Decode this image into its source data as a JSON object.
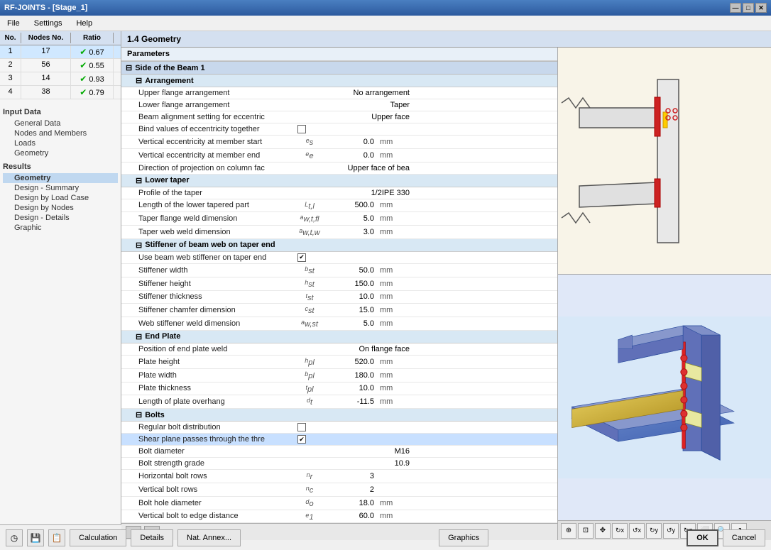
{
  "titlebar": {
    "title": "RF-JOINTS - [Stage_1]",
    "buttons": [
      "—",
      "□",
      "✕"
    ]
  },
  "menubar": {
    "items": [
      "File",
      "Settings",
      "Help"
    ]
  },
  "table": {
    "headers": [
      "No.",
      "Nodes No.",
      "Ratio"
    ],
    "rows": [
      {
        "no": "1",
        "nodes": "17",
        "status": "✔",
        "ratio": "0.67"
      },
      {
        "no": "2",
        "nodes": "56",
        "status": "✔",
        "ratio": "0.55"
      },
      {
        "no": "3",
        "nodes": "14",
        "status": "✔",
        "ratio": "0.93"
      },
      {
        "no": "4",
        "nodes": "38",
        "status": "✔",
        "ratio": "0.79"
      }
    ]
  },
  "nav": {
    "input_title": "Input Data",
    "input_items": [
      "General Data",
      "Nodes and Members",
      "Loads",
      "Geometry"
    ],
    "results_title": "Results",
    "results_items": [
      "Geometry",
      "Design - Summary",
      "Design by Load Case",
      "Design by Nodes",
      "Design - Details",
      "Graphic"
    ],
    "active": "Geometry"
  },
  "content_header": "1.4 Geometry",
  "params_label": "Parameters",
  "sections": [
    {
      "id": "side_beam1",
      "label": "Side of the Beam 1",
      "level": 1,
      "collapsed": false,
      "subsections": [
        {
          "id": "arrangement",
          "label": "Arrangement",
          "level": 2,
          "rows": [
            {
              "name": "Upper flange arrangement",
              "symbol": "",
              "value": "No arrangement",
              "unit": "",
              "type": "str"
            },
            {
              "name": "Lower flange arrangement",
              "symbol": "",
              "value": "Taper",
              "unit": "",
              "type": "str"
            },
            {
              "name": "Beam alignment setting for eccentric",
              "symbol": "",
              "value": "Upper face",
              "unit": "",
              "type": "str"
            },
            {
              "name": "Bind values of eccentricity together",
              "symbol": "",
              "value": "",
              "unit": "",
              "type": "check",
              "checked": false
            },
            {
              "name": "Vertical eccentricity at member start",
              "symbol": "es",
              "value": "0.0",
              "unit": "mm",
              "type": "num"
            },
            {
              "name": "Vertical eccentricity at member end",
              "symbol": "ee",
              "value": "0.0",
              "unit": "mm",
              "type": "num"
            },
            {
              "name": "Direction of projection on column fac",
              "symbol": "",
              "value": "Upper face of bea",
              "unit": "",
              "type": "str"
            }
          ]
        },
        {
          "id": "lower_taper",
          "label": "Lower taper",
          "level": 2,
          "rows": [
            {
              "name": "Profile of the taper",
              "symbol": "",
              "value": "1/2IPE 330",
              "unit": "",
              "type": "str"
            },
            {
              "name": "Length of the lower tapered part",
              "symbol": "Lt,l",
              "value": "500.0",
              "unit": "mm",
              "type": "num"
            },
            {
              "name": "Taper flange weld dimension",
              "symbol": "aw,t,fl",
              "value": "5.0",
              "unit": "mm",
              "type": "num"
            },
            {
              "name": "Taper web weld dimension",
              "symbol": "aw,t,w",
              "value": "3.0",
              "unit": "mm",
              "type": "num"
            }
          ]
        },
        {
          "id": "stiffener",
          "label": "Stiffener of beam web on taper end",
          "level": 2,
          "rows": [
            {
              "name": "Use beam web stiffener on taper end",
              "symbol": "",
              "value": "",
              "unit": "",
              "type": "check",
              "checked": true
            },
            {
              "name": "Stiffener width",
              "symbol": "bst",
              "value": "50.0",
              "unit": "mm",
              "type": "num"
            },
            {
              "name": "Stiffener height",
              "symbol": "hst",
              "value": "150.0",
              "unit": "mm",
              "type": "num"
            },
            {
              "name": "Stiffener thickness",
              "symbol": "tst",
              "value": "10.0",
              "unit": "mm",
              "type": "num"
            },
            {
              "name": "Stiffener chamfer dimension",
              "symbol": "cst",
              "value": "15.0",
              "unit": "mm",
              "type": "num"
            },
            {
              "name": "Web stiffener weld dimension",
              "symbol": "aw,st",
              "value": "5.0",
              "unit": "mm",
              "type": "num"
            }
          ]
        },
        {
          "id": "end_plate",
          "label": "End Plate",
          "level": 2,
          "rows": [
            {
              "name": "Position of end plate weld",
              "symbol": "",
              "value": "On flange face",
              "unit": "",
              "type": "str"
            },
            {
              "name": "Plate height",
              "symbol": "hpl",
              "value": "520.0",
              "unit": "mm",
              "type": "num"
            },
            {
              "name": "Plate width",
              "symbol": "bpl",
              "value": "180.0",
              "unit": "mm",
              "type": "num"
            },
            {
              "name": "Plate thickness",
              "symbol": "tpl",
              "value": "10.0",
              "unit": "mm",
              "type": "num"
            },
            {
              "name": "Length of plate overhang",
              "symbol": "dt",
              "value": "-11.5",
              "unit": "mm",
              "type": "num"
            }
          ]
        },
        {
          "id": "bolts",
          "label": "Bolts",
          "level": 2,
          "rows": [
            {
              "name": "Regular bolt distribution",
              "symbol": "",
              "value": "",
              "unit": "",
              "type": "check",
              "checked": false
            },
            {
              "name": "Shear plane passes through the thre",
              "symbol": "",
              "value": "",
              "unit": "",
              "type": "check",
              "checked": true
            },
            {
              "name": "Bolt diameter",
              "symbol": "",
              "value": "M16",
              "unit": "",
              "type": "str"
            },
            {
              "name": "Bolt strength grade",
              "symbol": "",
              "value": "10.9",
              "unit": "",
              "type": "str"
            },
            {
              "name": "Horizontal bolt rows",
              "symbol": "nr",
              "value": "3",
              "unit": "",
              "type": "num"
            },
            {
              "name": "Vertical bolt rows",
              "symbol": "nc",
              "value": "2",
              "unit": "",
              "type": "num"
            },
            {
              "name": "Bolt hole diameter",
              "symbol": "do",
              "value": "18.0",
              "unit": "mm",
              "type": "num"
            },
            {
              "name": "Vertical bolt to edge distance",
              "symbol": "e1",
              "value": "60.0",
              "unit": "mm",
              "type": "num"
            }
          ]
        }
      ]
    }
  ],
  "graphics_toolbar_buttons": [
    {
      "name": "zoom-in",
      "label": "+"
    },
    {
      "name": "zoom-fit",
      "label": "⊡"
    },
    {
      "name": "pan",
      "label": "✥"
    },
    {
      "name": "rotate-x",
      "label": "↻x"
    },
    {
      "name": "rotate-y",
      "label": "↻y"
    },
    {
      "name": "rotate-z",
      "label": "↻z"
    },
    {
      "name": "view-z",
      "label": "Z"
    },
    {
      "name": "view-iso",
      "label": "⬡"
    },
    {
      "name": "settings",
      "label": "⚙"
    },
    {
      "name": "export",
      "label": "↗"
    }
  ],
  "bottom_buttons": [
    {
      "id": "calculation",
      "label": "Calculation"
    },
    {
      "id": "details",
      "label": "Details"
    },
    {
      "id": "nat-annex",
      "label": "Nat. Annex..."
    },
    {
      "id": "graphics",
      "label": "Graphics"
    },
    {
      "id": "ok",
      "label": "OK"
    },
    {
      "id": "cancel",
      "label": "Cancel"
    }
  ]
}
